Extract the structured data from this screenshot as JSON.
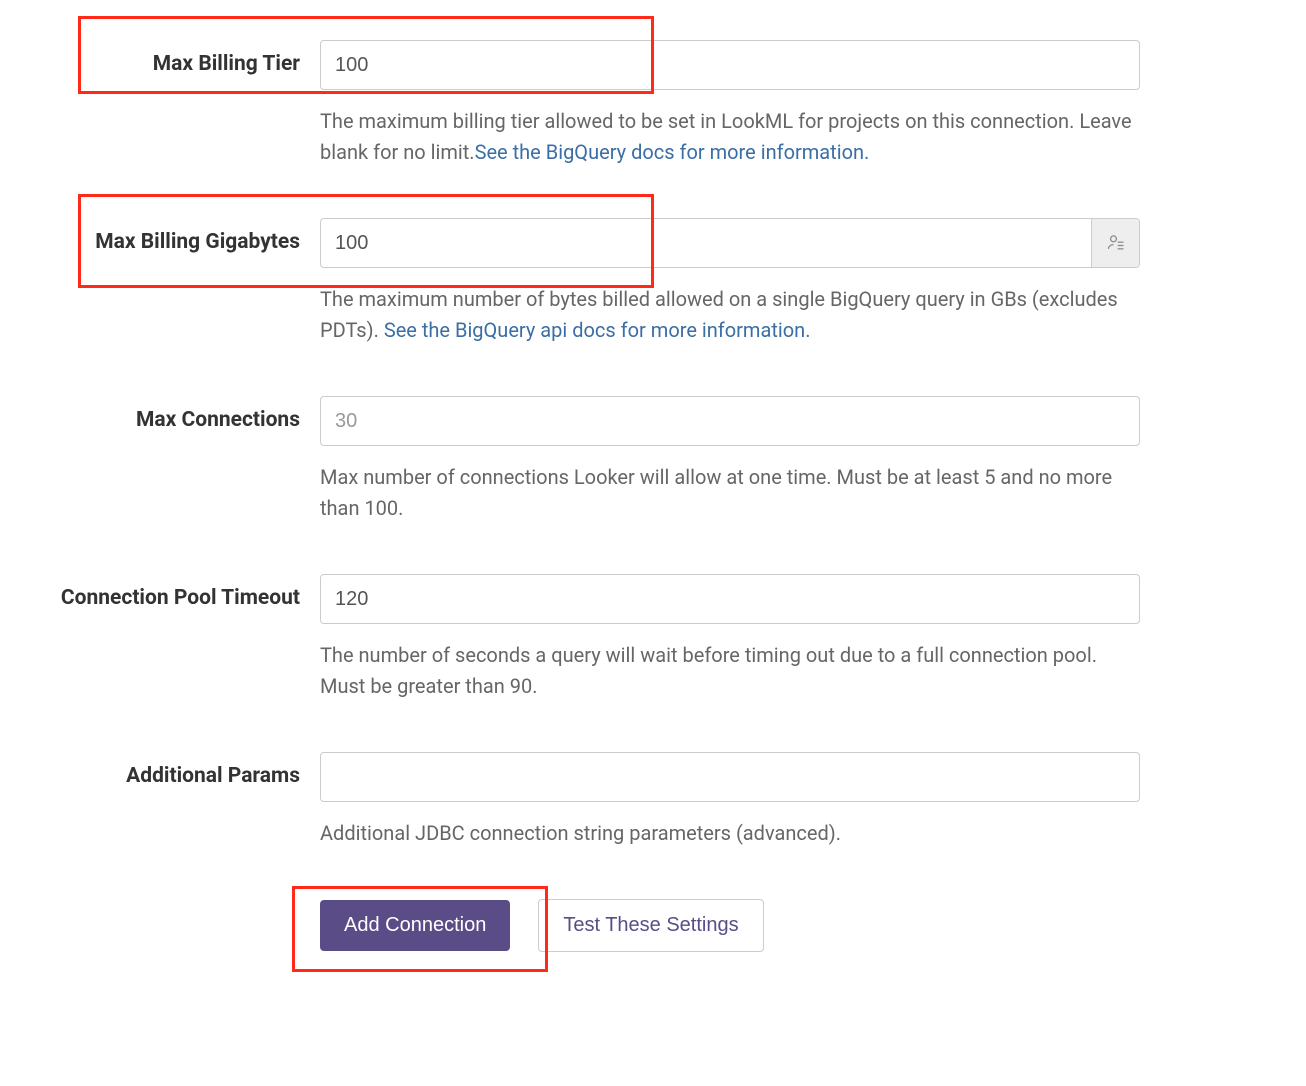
{
  "fields": {
    "max_billing_tier": {
      "label": "Max Billing Tier",
      "value": "100",
      "help_text_1": "The maximum billing tier allowed to be set in LookML for projects on this connection. Leave blank for no limit.",
      "help_link_text": "See the BigQuery docs for more information."
    },
    "max_billing_gigabytes": {
      "label": "Max Billing Gigabytes",
      "value": "100",
      "help_text_1": "The maximum number of bytes billed allowed on a single BigQuery query in GBs (excludes PDTs). ",
      "help_link_text": "See the BigQuery api docs for more information."
    },
    "max_connections": {
      "label": "Max Connections",
      "placeholder": "30",
      "help_text": "Max number of connections Looker will allow at one time. Must be at least 5 and no more than 100."
    },
    "connection_pool_timeout": {
      "label": "Connection Pool Timeout",
      "value": "120",
      "help_text": "The number of seconds a query will wait before timing out due to a full connection pool. Must be greater than 90."
    },
    "additional_params": {
      "label": "Additional Params",
      "help_text": "Additional JDBC connection string parameters (advanced)."
    }
  },
  "buttons": {
    "add_connection": "Add Connection",
    "test_settings": "Test These Settings"
  }
}
